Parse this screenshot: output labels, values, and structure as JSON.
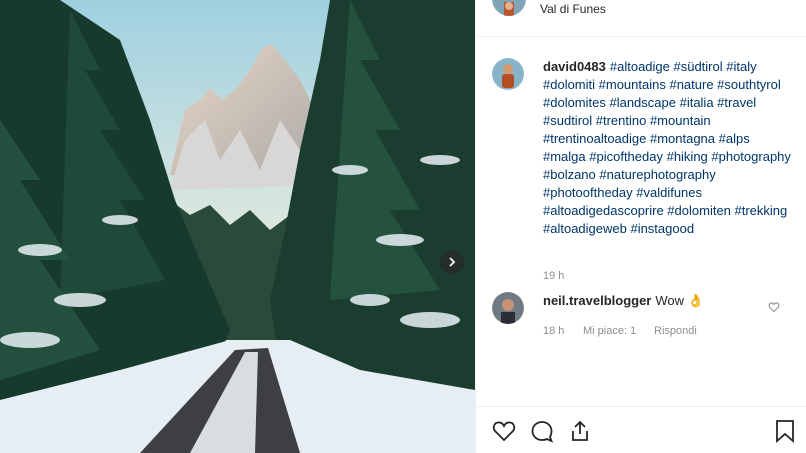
{
  "post": {
    "location": "Val di Funes",
    "username": "david0483",
    "hashtags": "#altoadige #südtirol #italy #dolomiti #mountains #nature #southtyrol #dolomites #landscape #italia #travel #sudtirol #trentino #mountain #trentinoaltoadige #montagna #alps #malga #picoftheday #hiking #photography #bolzano #naturephotography #photooftheday #valdifunes #altoadigedascoprire #dolomiten #trekking #altoadigeweb #instagood",
    "caption_time": "19 h"
  },
  "comment": {
    "username": "neil.travelblogger",
    "text": "Wow 👌",
    "time": "18 h",
    "likes": "Mi piace: 1",
    "reply": "Rispondi"
  },
  "icons": {
    "like": "heart-icon",
    "comment": "comment-icon",
    "share": "share-icon",
    "save": "bookmark-icon",
    "next": "chevron-right-icon"
  },
  "colors": {
    "hashtag": "#003569",
    "muted": "#8e8e8e"
  }
}
